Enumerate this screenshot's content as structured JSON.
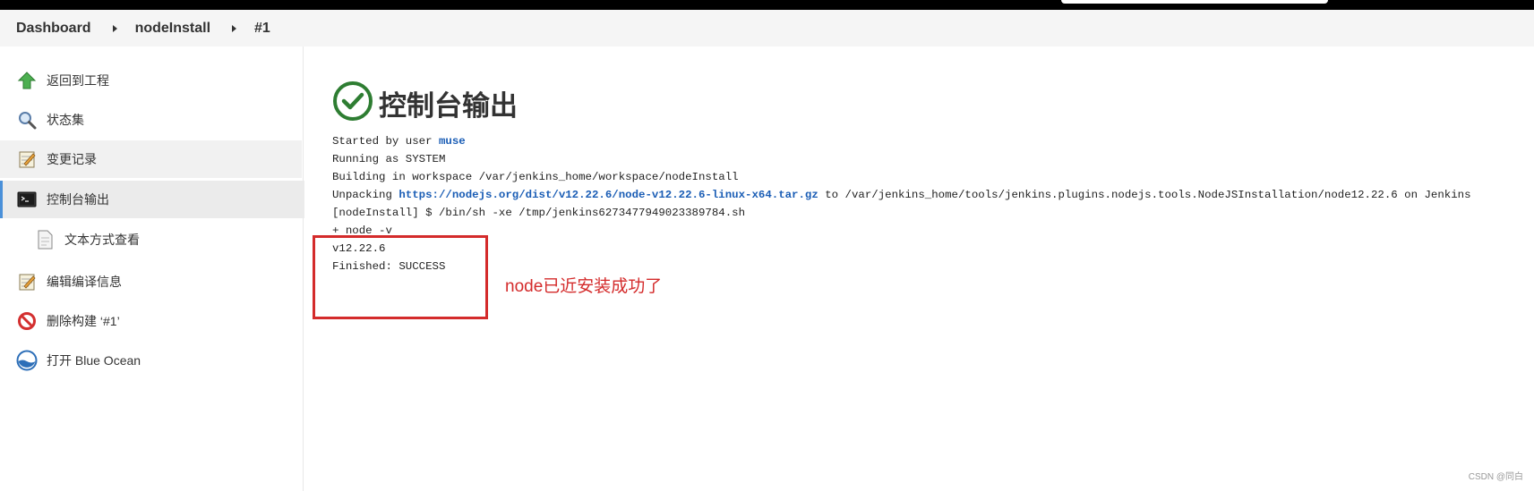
{
  "breadcrumb": {
    "items": [
      "Dashboard",
      "nodeInstall",
      "#1"
    ]
  },
  "sidebar": {
    "items": [
      {
        "label": "返回到工程",
        "icon": "up-arrow-icon"
      },
      {
        "label": "状态集",
        "icon": "magnifier-icon"
      },
      {
        "label": "变更记录",
        "icon": "notepad-icon"
      },
      {
        "label": "控制台输出",
        "icon": "terminal-icon"
      },
      {
        "label": "文本方式查看",
        "icon": "document-icon"
      },
      {
        "label": "编辑编译信息",
        "icon": "notepad-icon"
      },
      {
        "label": "删除构建 ‘#1’",
        "icon": "no-entry-icon"
      },
      {
        "label": "打开 Blue Ocean",
        "icon": "blue-ocean-icon"
      }
    ]
  },
  "main": {
    "title": "控制台输出",
    "console": {
      "line1_prefix": "Started by user ",
      "line1_user": "muse",
      "line2": "Running as SYSTEM",
      "line3": "Building in workspace /var/jenkins_home/workspace/nodeInstall",
      "line4_prefix": "Unpacking ",
      "line4_link": "https://nodejs.org/dist/v12.22.6/node-v12.22.6-linux-x64.tar.gz",
      "line4_suffix": " to /var/jenkins_home/tools/jenkins.plugins.nodejs.tools.NodeJSInstallation/node12.22.6 on Jenkins",
      "line5": "[nodeInstall] $ /bin/sh -xe /tmp/jenkins6273477949023389784.sh",
      "line6": "+ node -v",
      "line7": "v12.22.6",
      "line8": "Finished: SUCCESS"
    }
  },
  "annotation": {
    "text": "node已近安装成功了"
  },
  "watermark": "CSDN @同白",
  "colors": {
    "success_green": "#2e7d32",
    "link_blue": "#1a5db5",
    "annotation_red": "#d42b2b",
    "active_accent": "#4a90d9"
  }
}
